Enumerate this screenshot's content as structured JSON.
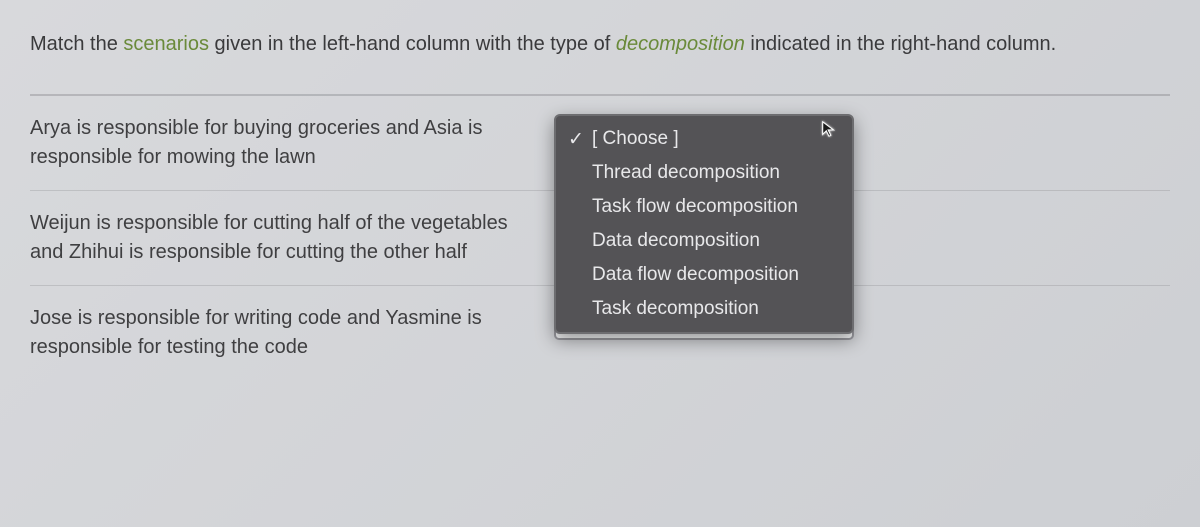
{
  "question": {
    "prefix": "Match the ",
    "hl1": "scenarios",
    "mid1": " given in the left-hand column with the type of ",
    "hl2": "decomposition",
    "mid2": " indicated in the right-hand column."
  },
  "placeholder": "[ Choose ]",
  "rows": [
    {
      "scenario": "Arya is responsible for buying groceries and Asia is responsible for mowing the lawn"
    },
    {
      "scenario": "Weijun is responsible for cutting half of the vegetables and Zhihui is responsible for cutting the other half"
    },
    {
      "scenario": "Jose is responsible for writing code and Yasmine is responsible for testing the code"
    }
  ],
  "dropdown": {
    "selected": "[ Choose ]",
    "options": [
      "Thread decomposition",
      "Task flow decomposition",
      "Data decomposition",
      "Data flow decomposition",
      "Task decomposition"
    ]
  }
}
